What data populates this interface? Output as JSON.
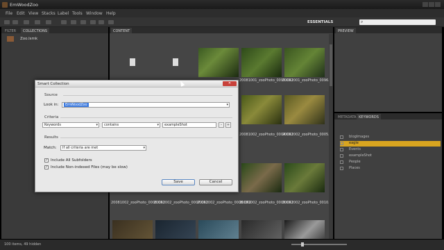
{
  "window": {
    "title": "EmWoodZoo",
    "controls": [
      "minimize",
      "maximize",
      "close"
    ]
  },
  "menu": [
    "File",
    "Edit",
    "View",
    "Stacks",
    "Label",
    "Tools",
    "Window",
    "Help"
  ],
  "toolbar": {
    "workspace": "ESSENTIALS",
    "search_placeholder": ""
  },
  "left_panel": {
    "tabs": [
      "FILTER",
      "COLLECTIONS"
    ],
    "active_tab": "COLLECTIONS",
    "collections": [
      {
        "label": "Zoo.lsmk",
        "icon": "collection-icon"
      }
    ]
  },
  "content_panel": {
    "tab": "CONTENT",
    "items": [
      {
        "caption": "",
        "kind": "document"
      },
      {
        "caption": "",
        "kind": "document"
      },
      {
        "caption": "",
        "kind": "photo-eagle"
      },
      {
        "caption": "20081001_zooPhoto_0095.CR2",
        "kind": "photo-eagle"
      },
      {
        "caption": "20081001_zooPhoto_0096.CR2",
        "kind": "photo-eagle"
      },
      {
        "caption": "20081002_zooPhoto_0004.CR2",
        "kind": "photo-deer"
      },
      {
        "caption": "20081002_zooPhoto_0005.CR2",
        "kind": "photo-deer"
      },
      {
        "caption": "20081002_zooPhoto_0006.CR2",
        "kind": "photo-animal"
      },
      {
        "caption": "20081002_zooPhoto_0007.CR2",
        "kind": "photo-animal"
      },
      {
        "caption": "20081002_zooPhoto_0008.CR2",
        "kind": "photo-animal"
      },
      {
        "caption": "20081002_zooPhoto_0009.CR2",
        "kind": "photo-animal"
      },
      {
        "caption": "20081002_zooPhoto_0010.CR2",
        "kind": "photo-animal"
      }
    ]
  },
  "right_panel": {
    "preview_tab": "PREVIEW",
    "tabs": [
      "METADATA",
      "KEYWORDS"
    ],
    "active_tab": "KEYWORDS",
    "keywords": [
      {
        "label": "blogImages",
        "count": "",
        "selected": false
      },
      {
        "label": "eagle",
        "count": "",
        "selected": true
      },
      {
        "label": "Events",
        "count": "",
        "selected": false
      },
      {
        "label": "exampleShot",
        "count": "",
        "selected": false
      },
      {
        "label": "People",
        "count": "",
        "selected": false
      },
      {
        "label": "Places",
        "count": "",
        "selected": false
      }
    ]
  },
  "status_bar": {
    "text": "100 items, 49 hidden"
  },
  "dialog": {
    "title": "Smart Collection",
    "source_heading": "Source",
    "look_in_label": "Look in:",
    "look_in_value": "EmWoodZoo",
    "criteria_heading": "Criteria",
    "criteria_field": "Keywords",
    "criteria_operator": "contains",
    "criteria_value": "exampleShot",
    "remove_label": "–",
    "add_label": "+",
    "results_heading": "Results",
    "match_label": "Match:",
    "match_value": "If all criteria are met",
    "include_subfolders_label": "Include All Subfolders",
    "include_subfolders_checked": true,
    "include_nonindexed_label": "Include Non-indexed Files (may be slow)",
    "include_nonindexed_checked": true,
    "save_label": "Save",
    "cancel_label": "Cancel",
    "close_glyph": "✕"
  },
  "colors": {
    "accent": "#d9a520",
    "selection": "#3d7be0",
    "panel_bg": "#3a3a3a",
    "content_bg": "#454545",
    "dialog_bg": "#e8e8e8"
  }
}
